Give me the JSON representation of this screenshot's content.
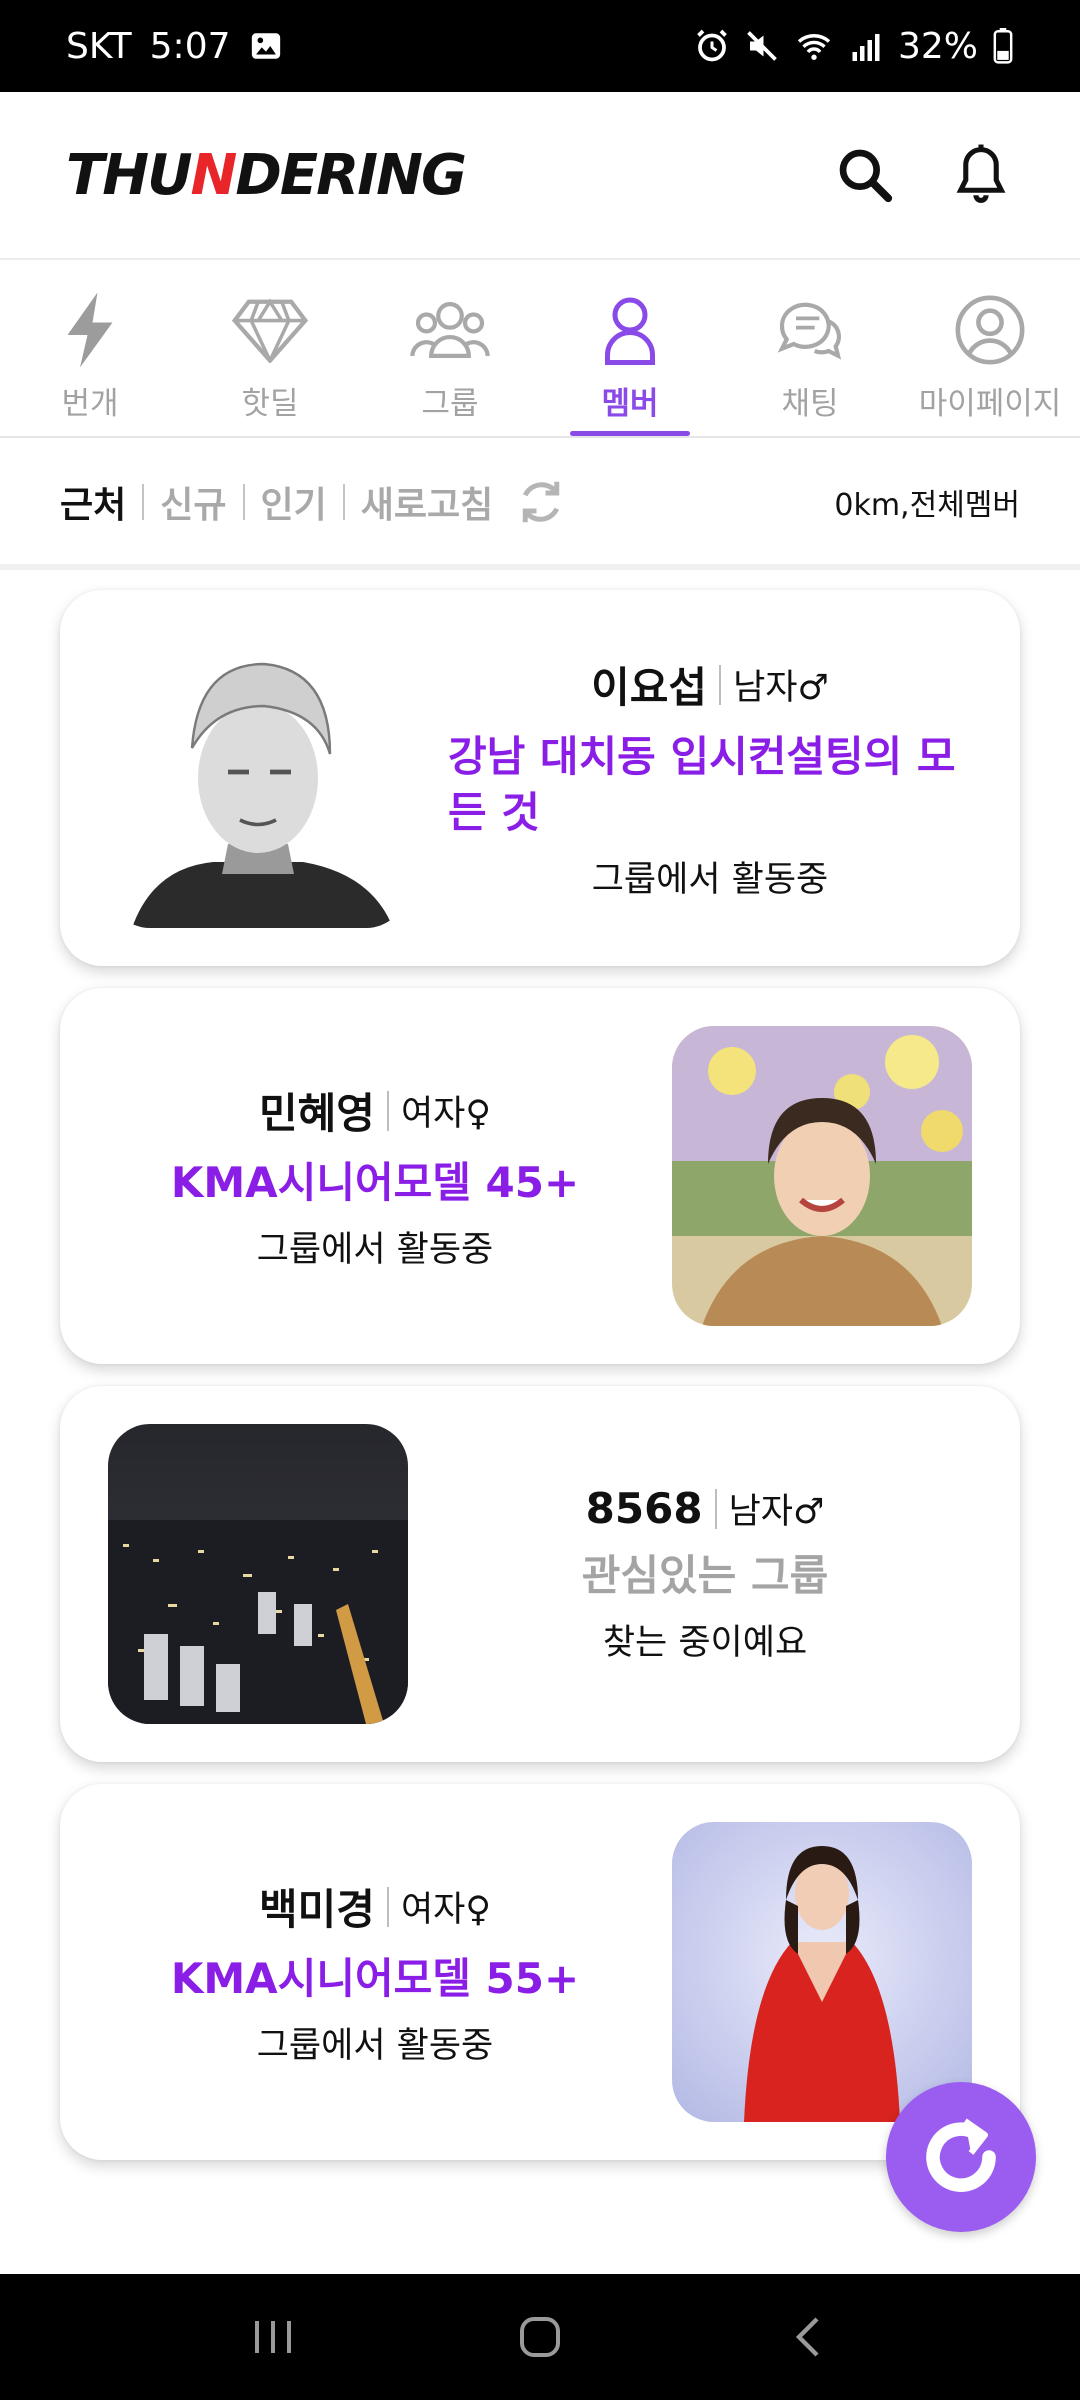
{
  "status_bar": {
    "carrier": "SKT",
    "time": "5:07",
    "battery": "32%"
  },
  "header": {
    "logo_left": "THU",
    "logo_mid": "N",
    "logo_right": "DERING"
  },
  "tabs": [
    {
      "label": "번개",
      "icon": "lightning-icon"
    },
    {
      "label": "핫딜",
      "icon": "diamond-icon"
    },
    {
      "label": "그룹",
      "icon": "group-icon"
    },
    {
      "label": "멤버",
      "icon": "member-icon",
      "active": true
    },
    {
      "label": "채팅",
      "icon": "chat-icon"
    },
    {
      "label": "마이페이지",
      "icon": "profile-icon"
    }
  ],
  "filters": {
    "items": [
      "근처",
      "신규",
      "인기",
      "새로고침"
    ],
    "active": "근처",
    "distance": "0km,전체멤버"
  },
  "members": [
    {
      "name": "이요섭",
      "gender": "남자♂",
      "tagline": "강남 대치동 입시컨설팅의 모든 것",
      "status": "그룹에서 활동중"
    },
    {
      "name": "민혜영",
      "gender": "여자♀",
      "tagline": "KMA시니어모델 45+",
      "status": "그룹에서 활동중"
    },
    {
      "name": "8568",
      "gender": "남자♂",
      "tagline": "관심있는 그룹",
      "status": "찾는 중이예요"
    },
    {
      "name": "백미경",
      "gender": "여자♀",
      "tagline": "KMA시니어모델 55+",
      "status": "그룹에서 활동중"
    }
  ],
  "colors": {
    "accent": "#8a1ee6",
    "tab_active": "#8a4ae8",
    "fab": "#9b5cf0",
    "logo_bolt": "#e8262a"
  }
}
